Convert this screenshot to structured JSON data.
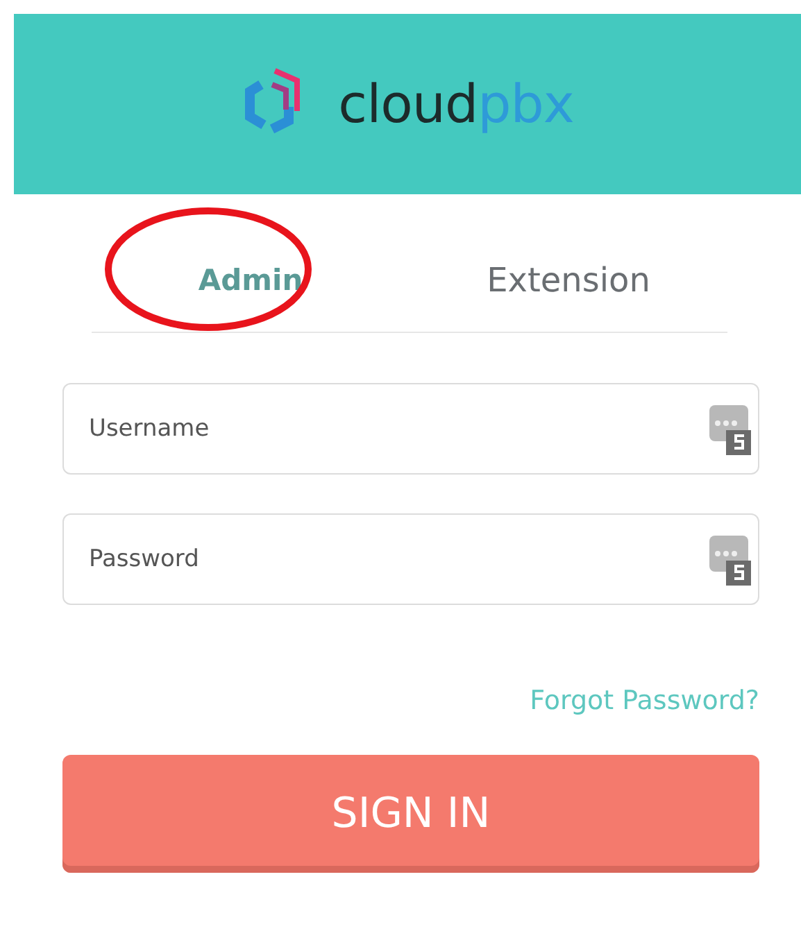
{
  "logo": {
    "name": "cloud",
    "suffix": "pbx"
  },
  "tabs": [
    {
      "label": "Admin",
      "selected": true,
      "circled": true
    },
    {
      "label": "Extension",
      "selected": false,
      "circled": false
    }
  ],
  "fields": [
    {
      "placeholder": "Username"
    },
    {
      "placeholder": "Password"
    }
  ],
  "forgot_link": "Forgot Password?",
  "submit": "SIGN IN"
}
